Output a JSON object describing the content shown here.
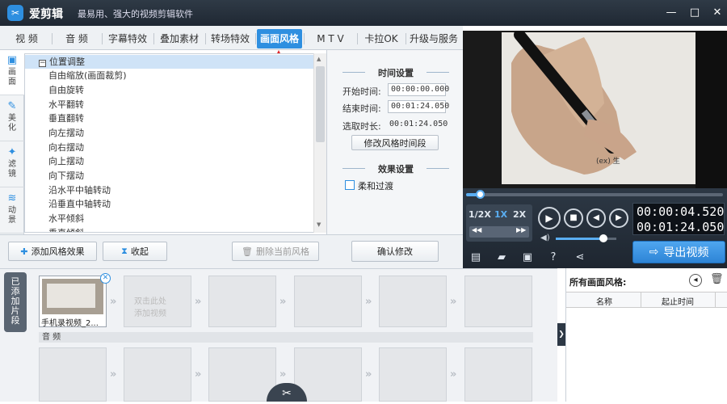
{
  "app": {
    "title": "爱剪辑",
    "slogan": "最易用、强大的视频剪辑软件",
    "accent": "#2e8fe0"
  },
  "tabs": [
    "视 频",
    "音 频",
    "字幕特效",
    "叠加素材",
    "转场特效",
    "画面风格",
    "M T V",
    "卡拉OK",
    "升级与服务"
  ],
  "active_tab": "画面风格",
  "side_nav": [
    {
      "label": "画面",
      "icon": "frame-icon"
    },
    {
      "label": "美化",
      "icon": "brush-icon"
    },
    {
      "label": "滤镜",
      "icon": "wand-icon"
    },
    {
      "label": "动景",
      "icon": "wave-icon"
    }
  ],
  "style_list": {
    "group": "位置调整",
    "items": [
      "自由缩放(画面裁剪)",
      "自由旋转",
      "水平翻转",
      "垂直翻转",
      "向左摆动",
      "向右摆动",
      "向上摆动",
      "向下摆动",
      "沿水平中轴转动",
      "沿垂直中轴转动",
      "水平倾斜",
      "垂直倾斜"
    ]
  },
  "buttons": {
    "add_style": "添加风格效果",
    "collapse": "收起",
    "delete_style": "删除当前风格",
    "confirm": "确认修改",
    "edit_time": "修改风格时间段",
    "export": "导出视频"
  },
  "time_settings": {
    "section_title": "时间设置",
    "start_label": "开始时间:",
    "start_value": "00:00:00.000",
    "end_label": "结束时间:",
    "end_value": "00:01:24.050",
    "duration_label": "选取时长:",
    "duration_value": "00:01:24.050"
  },
  "effect_settings": {
    "section_title": "效果设置",
    "soft_transition": "柔和过渡",
    "soft_transition_checked": false
  },
  "player": {
    "speeds": [
      "1/2X",
      "1X",
      "2X"
    ],
    "active_speed": "1X",
    "current_time": "00:00:04.520",
    "total_time": "00:01:24.050",
    "progress_fraction": 0.054,
    "volume_fraction": 0.78,
    "video_caption": "(ex) 生"
  },
  "tracks": {
    "added_tab": "已添加片段",
    "clip_name": "手机录视频_2...",
    "placeholder": "双击此处\n添加视频",
    "audio_label": "音 频"
  },
  "right_panel": {
    "title": "所有画面风格:",
    "col_name": "名称",
    "col_time": "起止时间"
  }
}
